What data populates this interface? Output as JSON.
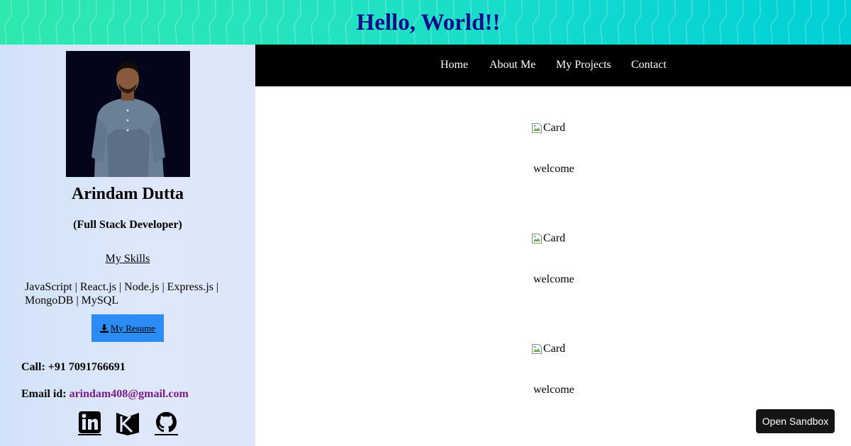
{
  "header": {
    "title": "Hello, World!!"
  },
  "profile": {
    "name": "Arindam Dutta",
    "role": "(Full Stack Developer)",
    "skills_link": "My Skills",
    "skills": "JavaScript | React.js | Node.js | Express.js | MongoDB | MySQL",
    "resume_label": "My Resume",
    "call_label": "Call:",
    "phone": "+91 7091766691",
    "email_label": "Email id:",
    "email": "arindam408@gmail.com",
    "socials": [
      "linkedin-icon",
      "kaggle-icon",
      "github-icon"
    ]
  },
  "nav": {
    "items": [
      "Home",
      "About Me",
      "My Projects",
      "Contact"
    ]
  },
  "cards": [
    {
      "alt": "Card",
      "caption": "welcome"
    },
    {
      "alt": "Card",
      "caption": "welcome"
    },
    {
      "alt": "Card",
      "caption": "welcome"
    }
  ],
  "sandbox": {
    "label": "Open Sandbox"
  },
  "colors": {
    "header_title": "#0d0d8c",
    "resume_button": "#2b8cf6",
    "email_link": "#7a1a8a",
    "nav_bg": "#000000"
  }
}
